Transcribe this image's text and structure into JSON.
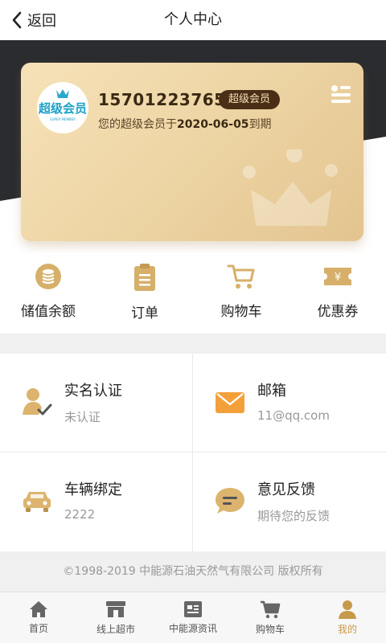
{
  "header": {
    "back_label": "返回",
    "title": "个人中心"
  },
  "member_card": {
    "logo_text": "超级会员",
    "logo_subtext": "SUPER MEMBER",
    "phone": "15701223765",
    "badge": "超级会员",
    "expire_prefix": "您的超级会员于",
    "expire_date": "2020-06-05",
    "expire_suffix": "到期"
  },
  "quick_actions": [
    {
      "label": "储值余额",
      "icon": "coins-icon"
    },
    {
      "label": "订单",
      "icon": "clipboard-icon"
    },
    {
      "label": "购物车",
      "icon": "cart-icon"
    },
    {
      "label": "优惠券",
      "icon": "coupon-icon"
    }
  ],
  "services": [
    {
      "title": "实名认证",
      "subtitle": "未认证",
      "icon": "user-check-icon"
    },
    {
      "title": "邮箱",
      "subtitle": "11@qq.com",
      "icon": "mail-icon"
    },
    {
      "title": "车辆绑定",
      "subtitle": "2222",
      "icon": "car-icon"
    },
    {
      "title": "意见反馈",
      "subtitle": "期待您的反馈",
      "icon": "chat-icon"
    }
  ],
  "copyright": "©1998-2019 中能源石油天然气有限公司 版权所有",
  "tabbar": [
    {
      "label": "首页",
      "icon": "home-icon"
    },
    {
      "label": "线上超市",
      "icon": "store-icon"
    },
    {
      "label": "中能源资讯",
      "icon": "news-icon"
    },
    {
      "label": "购物车",
      "icon": "cart-icon"
    },
    {
      "label": "我的",
      "icon": "user-icon",
      "active": true
    }
  ],
  "colors": {
    "accent_gold": "#c79a4b",
    "dark_band": "#2b2c2f",
    "badge_bg": "#4a2f16"
  }
}
